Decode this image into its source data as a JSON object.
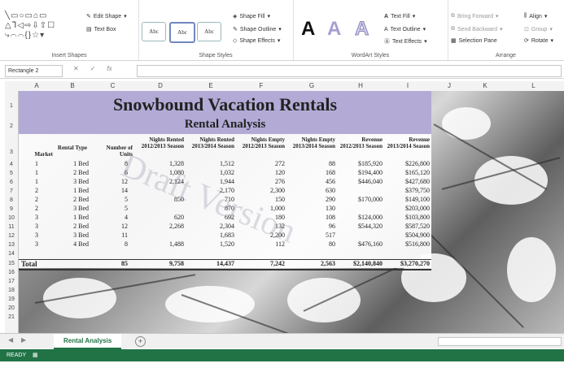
{
  "ribbon": {
    "insert_shapes": {
      "label": "Insert Shapes",
      "edit_shape": "Edit Shape",
      "text_box": "Text Box",
      "shapes_glyphs": "╲▭○▭⌂▭ △⅂◁⇨⇩⇧☐ ⤷⌒⌒{}☆▾"
    },
    "shape_styles": {
      "label": "Shape Styles",
      "style_sample": "Abc",
      "fill": "Shape Fill",
      "outline": "Shape Outline",
      "effects": "Shape Effects"
    },
    "wordart": {
      "label": "WordArt Styles",
      "letter": "A",
      "text_fill": "Text Fill",
      "text_outline": "Text Outline",
      "text_effects": "Text Effects"
    },
    "arrange": {
      "label": "Arrange",
      "bring_forward": "Bring Forward",
      "send_backward": "Send Backward",
      "selection_pane": "Selection Pane",
      "align": "Align",
      "group": "Group",
      "rotate": "Rotate"
    }
  },
  "formula_bar": {
    "name_box": "Rectangle 2",
    "cancel": "✕",
    "enter": "✓",
    "fx": "fx",
    "value": ""
  },
  "columns": [
    "A",
    "B",
    "C",
    "D",
    "E",
    "F",
    "G",
    "H",
    "I",
    "J",
    "K",
    "L"
  ],
  "rows": [
    "1",
    "2",
    "3",
    "4",
    "5",
    "6",
    "7",
    "8",
    "9",
    "10",
    "11",
    "12",
    "13",
    "14",
    "15",
    "16",
    "17",
    "18",
    "19",
    "20",
    "21"
  ],
  "sheet": {
    "title": "Snowbound Vacation Rentals",
    "subtitle": "Rental Analysis",
    "watermark": "Draft Version",
    "headers": {
      "market": "Market",
      "rental_type": "Rental Type",
      "units": "Number of Units",
      "rented_1213": "Nights Rented 2012/2013 Season",
      "rented_1314": "Nights Rented 2013/2014 Season",
      "empty_1213": "Nights Empty 2012/2013 Season",
      "empty_1314": "Nights Empty 2013/2014 Season",
      "rev_1213": "Revenue 2012/2013 Season",
      "rev_1314": "Revenue 2013/2014 Season"
    },
    "data_rows": [
      [
        "1",
        "1 Bed",
        "8",
        "1,328",
        "1,512",
        "272",
        "88",
        "$185,920",
        "$226,800"
      ],
      [
        "1",
        "2 Bed",
        "6",
        "1,080",
        "1,032",
        "120",
        "168",
        "$194,400",
        "$165,120"
      ],
      [
        "1",
        "3 Bed",
        "12",
        "2,124",
        "1,944",
        "276",
        "456",
        "$446,040",
        "$427,680"
      ],
      [
        "2",
        "1 Bed",
        "14",
        "",
        "2,170",
        "2,300",
        "630",
        "",
        "$379,750"
      ],
      [
        "2",
        "2 Bed",
        "5",
        "850",
        "710",
        "150",
        "290",
        "$170,000",
        "$149,100"
      ],
      [
        "2",
        "3 Bed",
        "5",
        "",
        "870",
        "1,000",
        "130",
        "",
        "$203,000"
      ],
      [
        "3",
        "1 Bed",
        "4",
        "620",
        "692",
        "180",
        "108",
        "$124,000",
        "$103,800"
      ],
      [
        "3",
        "2 Bed",
        "12",
        "2,268",
        "2,304",
        "132",
        "96",
        "$544,320",
        "$587,520"
      ],
      [
        "3",
        "3 Bed",
        "11",
        "",
        "1,683",
        "2,200",
        "517",
        "",
        "$504,900"
      ],
      [
        "3",
        "4 Bed",
        "8",
        "1,488",
        "1,520",
        "112",
        "80",
        "$476,160",
        "$516,800"
      ]
    ],
    "total": [
      "Total",
      "",
      "85",
      "9,758",
      "14,437",
      "7,242",
      "2,563",
      "$2,140,840",
      "$3,270,270"
    ]
  },
  "tabs": {
    "active": "Rental Analysis",
    "add": "+",
    "prev": "◀",
    "next": "▶"
  },
  "status": {
    "ready": "READY",
    "icon": "▦"
  },
  "colors": {
    "accent": "#217346",
    "title_band": "#b3abd6"
  }
}
